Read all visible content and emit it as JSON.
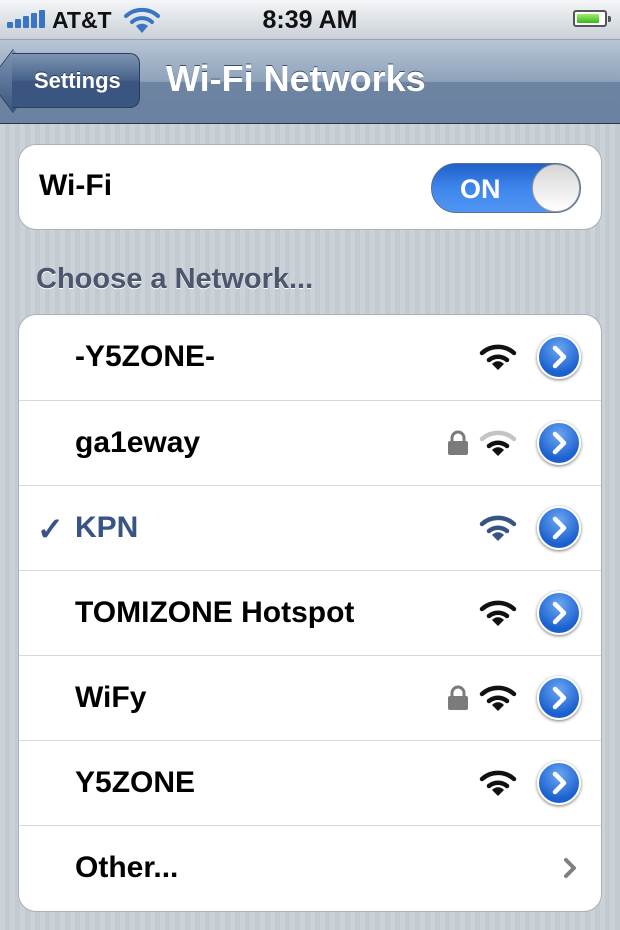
{
  "status_bar": {
    "carrier": "AT&T",
    "time": "8:39 AM",
    "signal_icon": "signal-bars-icon",
    "wifi_icon": "wifi-icon",
    "battery_icon": "battery-icon",
    "battery_level": 0.85
  },
  "nav": {
    "back_label": "Settings",
    "title": "Wi-Fi Networks"
  },
  "wifi": {
    "label": "Wi-Fi",
    "toggle_label": "ON",
    "enabled": true
  },
  "section_header": "Choose a Network...",
  "networks": [
    {
      "name": "-Y5ZONE-",
      "secured": false,
      "selected": false,
      "signal": "strong"
    },
    {
      "name": "ga1eway",
      "secured": true,
      "selected": false,
      "signal": "weak"
    },
    {
      "name": "KPN",
      "secured": false,
      "selected": true,
      "signal": "strong"
    },
    {
      "name": "TOMIZONE Hotspot",
      "secured": false,
      "selected": false,
      "signal": "strong"
    },
    {
      "name": "WiFy",
      "secured": true,
      "selected": false,
      "signal": "strong"
    },
    {
      "name": "Y5ZONE",
      "secured": false,
      "selected": false,
      "signal": "strong"
    }
  ],
  "selected_mark": "✓",
  "other": {
    "label": "Other..."
  },
  "colors": {
    "accent_blue": "#385487",
    "toggle_blue": "#3f86ec",
    "detail_blue": "#1c60cf"
  }
}
